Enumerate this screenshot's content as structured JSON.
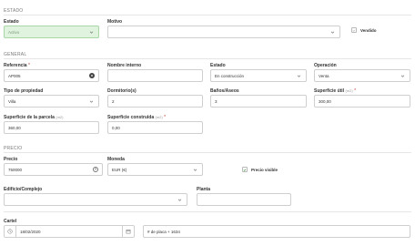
{
  "sections": {
    "estado": "ESTADO",
    "general": "GENERAL",
    "precio": "PRECIO"
  },
  "estado": {
    "estado_label": "Estado",
    "estado_value": "Activo",
    "motivo_label": "Motivo",
    "motivo_value": "",
    "vendido_label": "Vendido"
  },
  "general": {
    "referencia_label": "Referencia",
    "referencia_value": "AP005",
    "nombre_label": "Nombre interno",
    "nombre_value": "",
    "estado_label": "Estado",
    "estado_value": "En construcción",
    "operacion_label": "Operación",
    "operacion_value": "Venta",
    "tipo_label": "Tipo de propiedad",
    "tipo_value": "Villa",
    "dormitorios_label": "Dormitorio(s)",
    "dormitorios_value": "2",
    "banos_label": "Baños/Aseos",
    "banos_value": "3",
    "sup_util_label": "Superficie útil",
    "sup_util_unit": "(m2)",
    "sup_util_value": "300,00",
    "sup_parcela_label": "Superficie de la parcela",
    "sup_parcela_unit": "(m2)",
    "sup_parcela_value": "360,00",
    "sup_construida_label": "Superficie construida",
    "sup_construida_unit": "(m2)",
    "sup_construida_value": "0,00"
  },
  "precio": {
    "precio_label": "Precio",
    "precio_value": "750000",
    "moneda_label": "Moneda",
    "moneda_value": "EUR (€)",
    "precio_visible_label": "Precio visible",
    "edificio_label": "Edificio/Complejo",
    "edificio_value": "",
    "planta_label": "Planta",
    "planta_value": ""
  },
  "cartel": {
    "label": "Cartel",
    "date_value": "18/02/2020",
    "placa_value": "# de placa + 1634"
  },
  "colors": {
    "accent_green_bg": "#dff3de",
    "required": "#c0392b"
  }
}
